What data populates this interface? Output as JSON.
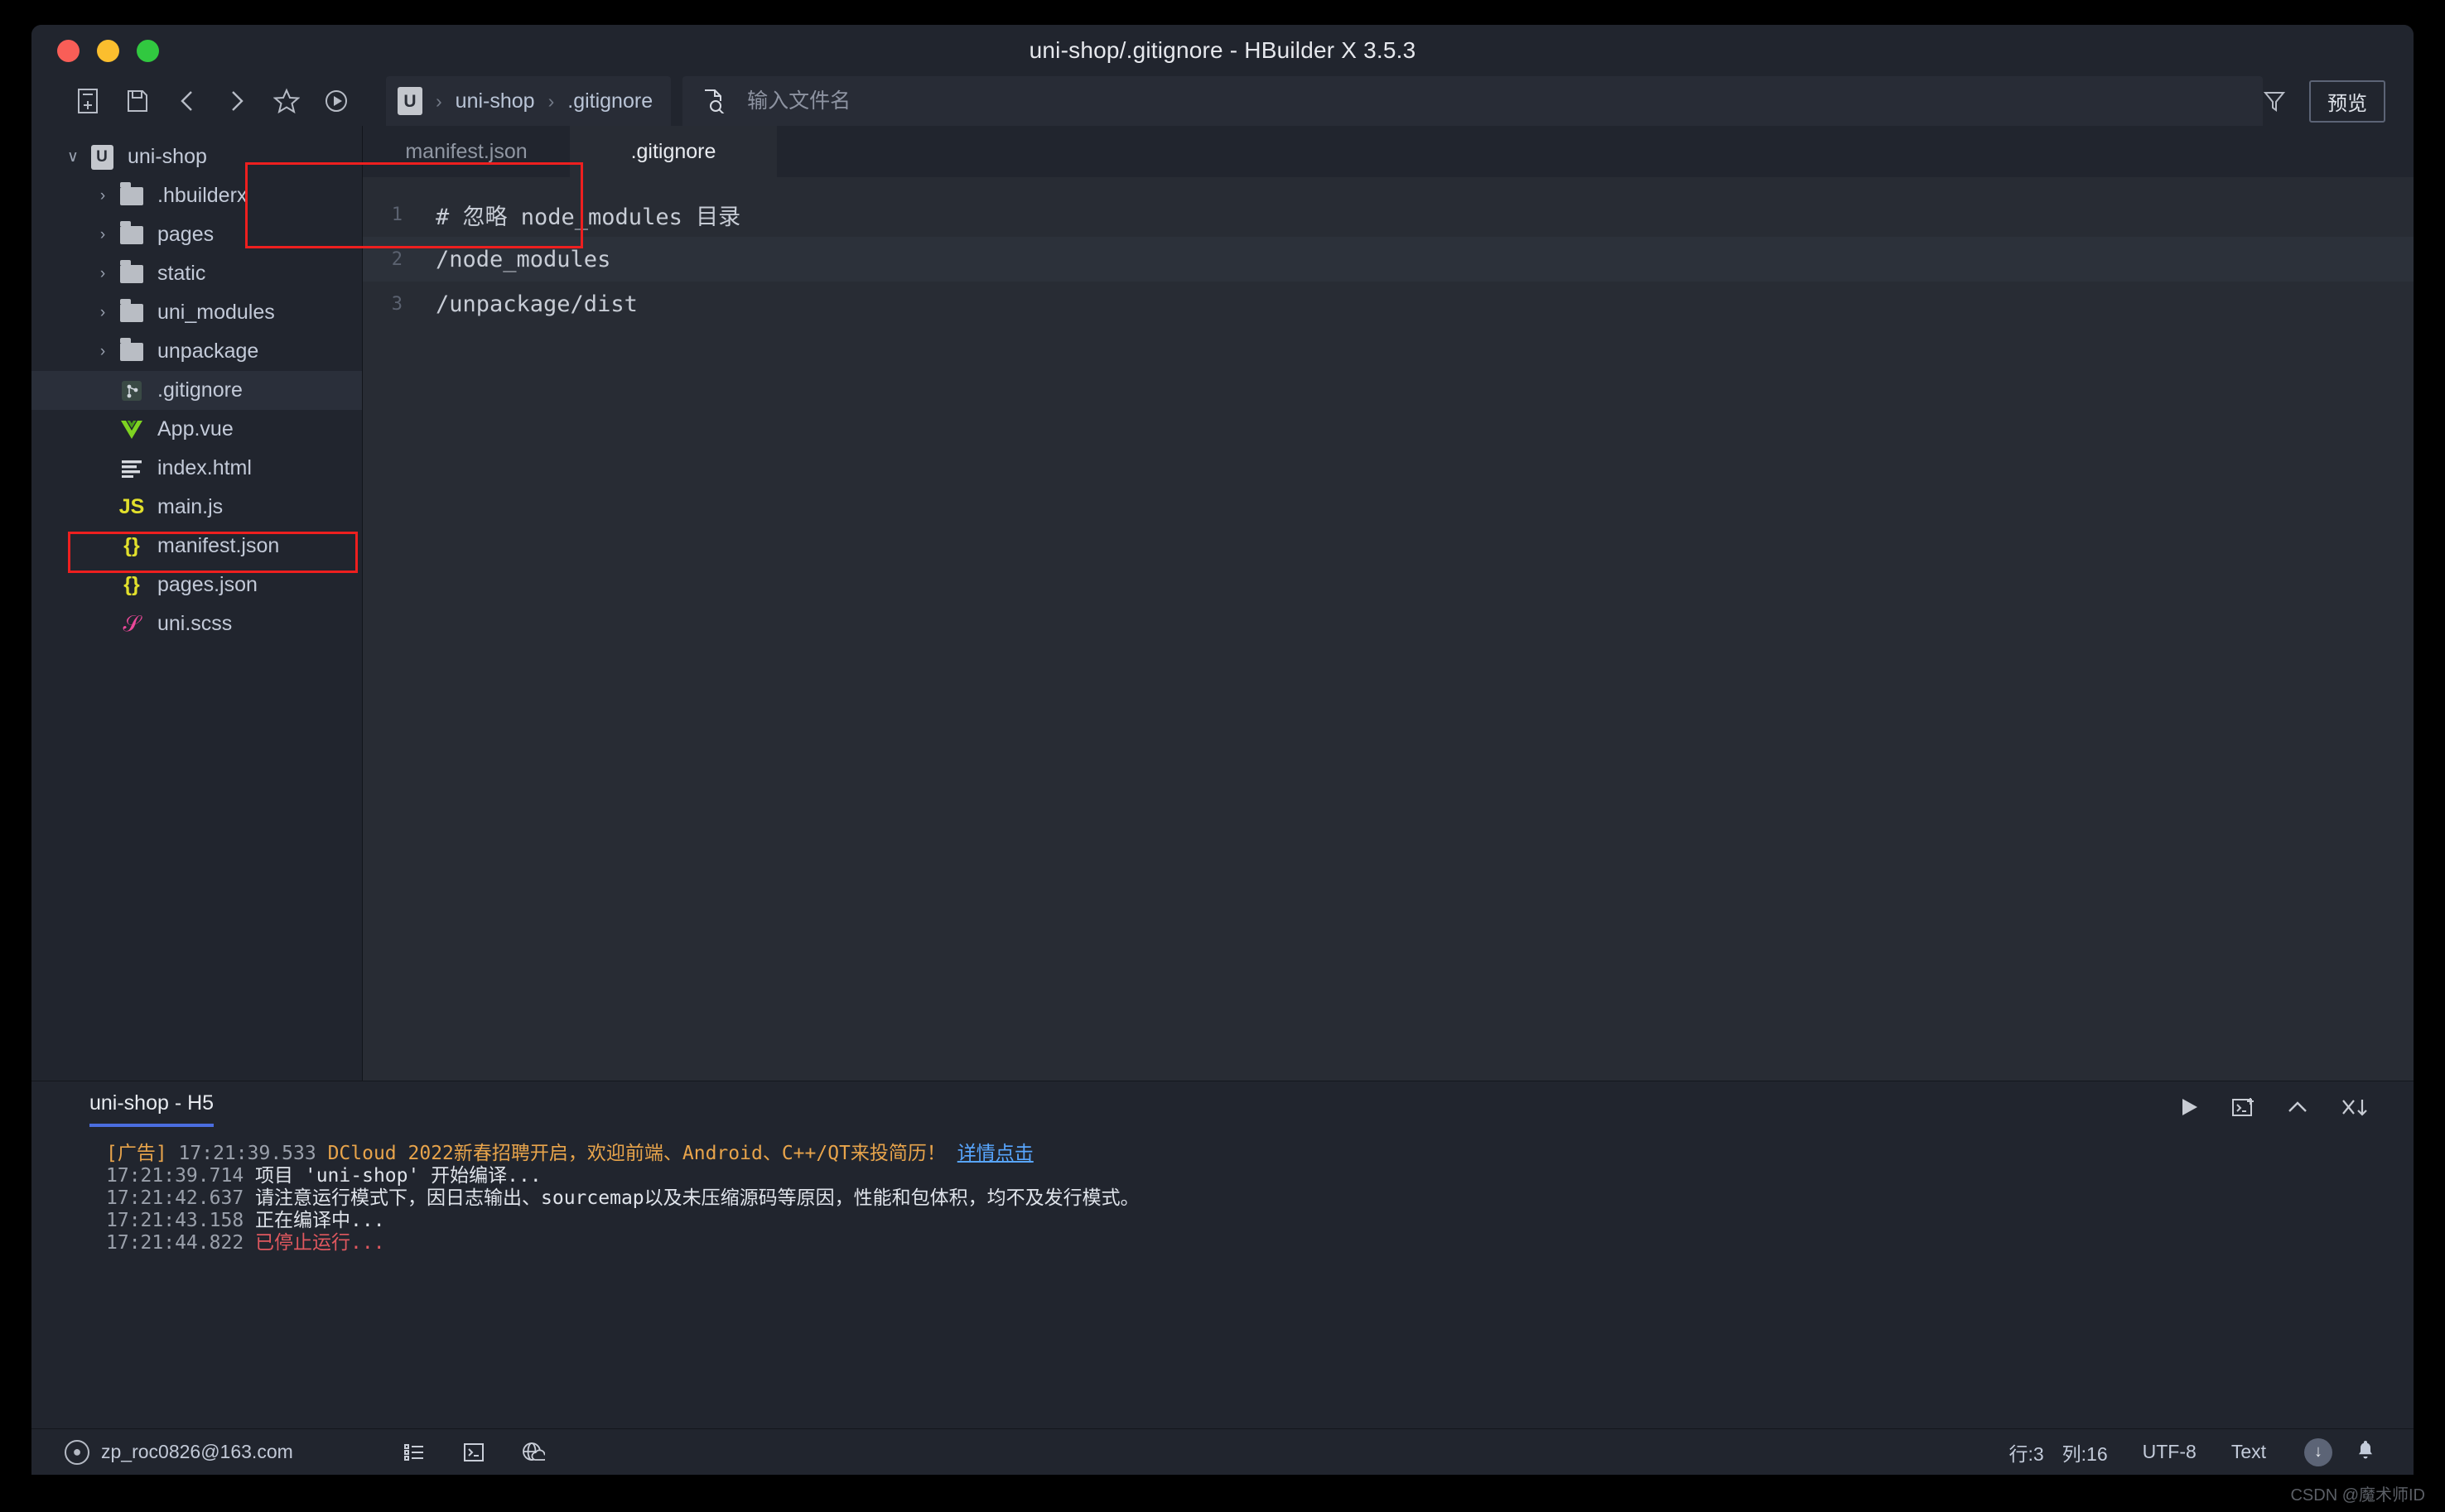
{
  "window": {
    "title": "uni-shop/.gitignore - HBuilder X 3.5.3",
    "traffic": {
      "close": "close-button",
      "minimize": "minimize-button",
      "zoom": "zoom-button"
    }
  },
  "toolbar": {
    "icons": [
      {
        "name": "new-file-icon",
        "label": "新建"
      },
      {
        "name": "save-icon",
        "label": "保存"
      },
      {
        "name": "back-icon",
        "label": "后退"
      },
      {
        "name": "forward-icon",
        "label": "前进"
      },
      {
        "name": "favorite-star-icon",
        "label": "收藏"
      },
      {
        "name": "run-icon",
        "label": "运行"
      }
    ],
    "breadcrumb": {
      "logo": "U",
      "project": "uni-shop",
      "file": ".gitignore",
      "separator": "›"
    },
    "search": {
      "placeholder": "输入文件名",
      "value": ""
    },
    "filter_icon": "funnel-icon",
    "preview_label": "预览"
  },
  "sidebar": {
    "items": [
      {
        "label": "uni-shop",
        "type": "project",
        "depth": 0,
        "arrow": "∨",
        "selected": false
      },
      {
        "label": ".hbuilderx",
        "type": "folder",
        "depth": 1,
        "arrow": "›",
        "selected": false
      },
      {
        "label": "pages",
        "type": "folder",
        "depth": 1,
        "arrow": "›",
        "selected": false
      },
      {
        "label": "static",
        "type": "folder",
        "depth": 1,
        "arrow": "›",
        "selected": false
      },
      {
        "label": "uni_modules",
        "type": "folder",
        "depth": 1,
        "arrow": "›",
        "selected": false
      },
      {
        "label": "unpackage",
        "type": "folder",
        "depth": 1,
        "arrow": "›",
        "selected": false
      },
      {
        "label": ".gitignore",
        "type": "git",
        "depth": 1,
        "arrow": "",
        "selected": true
      },
      {
        "label": "App.vue",
        "type": "vue",
        "depth": 1,
        "arrow": "",
        "selected": false
      },
      {
        "label": "index.html",
        "type": "html",
        "depth": 1,
        "arrow": "",
        "selected": false
      },
      {
        "label": "main.js",
        "type": "js",
        "depth": 1,
        "arrow": "",
        "selected": false
      },
      {
        "label": "manifest.json",
        "type": "json",
        "depth": 1,
        "arrow": "",
        "selected": false
      },
      {
        "label": "pages.json",
        "type": "json",
        "depth": 1,
        "arrow": "",
        "selected": false
      },
      {
        "label": "uni.scss",
        "type": "scss",
        "depth": 1,
        "arrow": "",
        "selected": false
      }
    ]
  },
  "editor": {
    "tabs": [
      {
        "label": "manifest.json",
        "active": false
      },
      {
        "label": ".gitignore",
        "active": true
      }
    ],
    "lines": [
      {
        "no": "1",
        "text": "# 忽略 node_modules 目录"
      },
      {
        "no": "2",
        "text": "/node_modules"
      },
      {
        "no": "3",
        "text": "/unpackage/dist"
      }
    ]
  },
  "console": {
    "tab": "uni-shop - H5",
    "actions": [
      {
        "name": "run-icon",
        "glyph": "▶"
      },
      {
        "name": "new-terminal-icon",
        "glyph": "terminal-plus"
      },
      {
        "name": "collapse-panel-icon",
        "glyph": "∧"
      },
      {
        "name": "close-all-icon",
        "glyph": "close-down"
      }
    ],
    "logs": [
      {
        "prefix": "[广告] ",
        "time": "17:21:39.533",
        "message": " DCloud 2022新春招聘开启，欢迎前端、Android、C++/QT来投简历！ ",
        "link": "详情点击",
        "style": "ad"
      },
      {
        "prefix": "",
        "time": "17:21:39.714",
        "message": " 项目 'uni-shop' 开始编译...",
        "link": "",
        "style": "normal"
      },
      {
        "prefix": "",
        "time": "17:21:42.637",
        "message": " 请注意运行模式下，因日志输出、sourcemap以及未压缩源码等原因，性能和包体积，均不及发行模式。",
        "link": "",
        "style": "normal"
      },
      {
        "prefix": "",
        "time": "17:21:43.158",
        "message": " 正在编译中...",
        "link": "",
        "style": "normal"
      },
      {
        "prefix": "",
        "time": "17:21:44.822",
        "message": " 已停止运行...",
        "link": "",
        "style": "stop"
      }
    ]
  },
  "statusbar": {
    "account": "zp_roc0826@163.com",
    "icons": [
      {
        "name": "outline-list-icon"
      },
      {
        "name": "terminal-icon"
      },
      {
        "name": "cloud-globe-icon"
      }
    ],
    "line": "行:3",
    "column": "列:16",
    "encoding": "UTF-8",
    "filetype": "Text",
    "download_icon": "download-icon",
    "bell_icon": "bell-icon"
  },
  "watermark": "CSDN @魔术师ID",
  "colors": {
    "accent": "#4b6ee0",
    "annotation": "#ee1f1f",
    "warn": "#e8a44b",
    "error": "#e0585f",
    "link": "#58a6ff",
    "window_bg": "#21252e",
    "editor_bg": "#282c34"
  }
}
